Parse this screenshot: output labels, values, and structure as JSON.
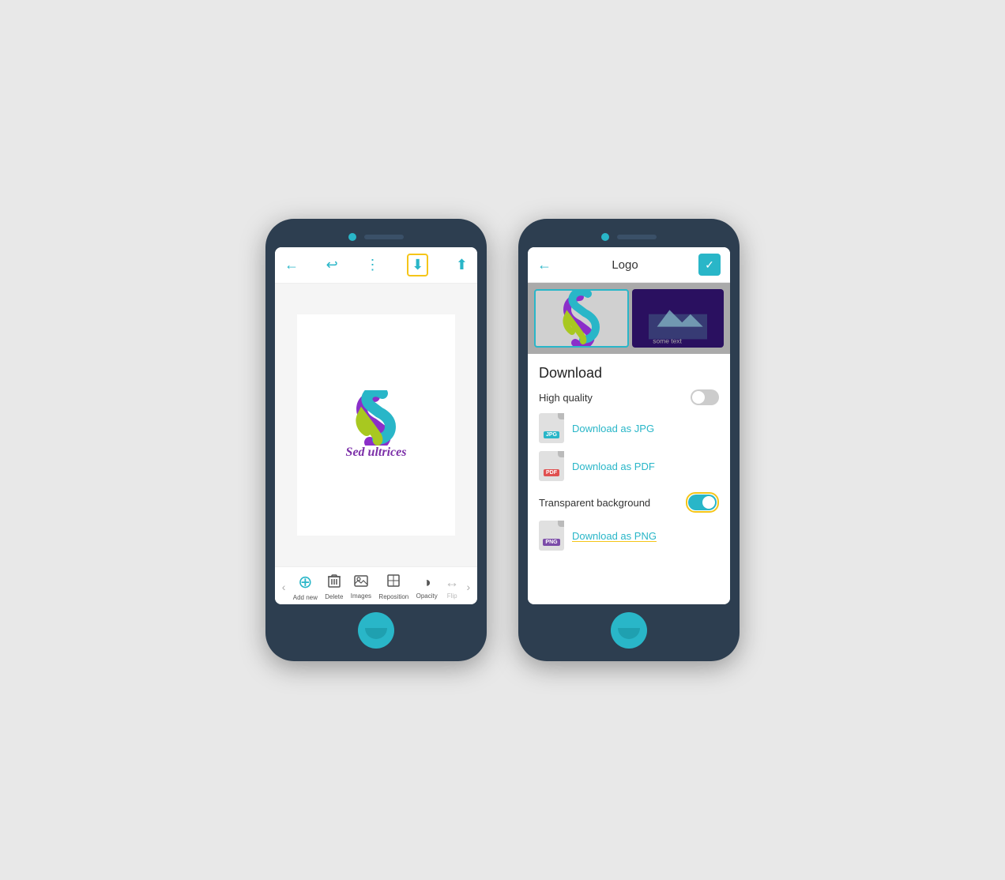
{
  "left_phone": {
    "toolbar": {
      "back_label": "←",
      "undo_label": "↩",
      "more_label": "⋮",
      "download_label": "⬇",
      "share_label": "⬆"
    },
    "canvas": {
      "logo_text": "Sed ultrices"
    },
    "bottom_bar": {
      "items": [
        {
          "label": "Add new",
          "icon": "⊕"
        },
        {
          "label": "Delete",
          "icon": "🗑"
        },
        {
          "label": "Images",
          "icon": "🖼"
        },
        {
          "label": "Reposition",
          "icon": "⊹"
        },
        {
          "label": "Opacity",
          "icon": "◑"
        },
        {
          "label": "Flip",
          "icon": "↔"
        }
      ],
      "nav_right": "›"
    }
  },
  "right_phone": {
    "header": {
      "back_label": "←",
      "title": "Logo",
      "check_label": "✓"
    },
    "download_panel": {
      "title": "Download",
      "high_quality_label": "High quality",
      "high_quality_on": false,
      "options": [
        {
          "badge": "JPG",
          "badge_class": "badge-jpg",
          "link_text": "Download as JPG"
        },
        {
          "badge": "PDF",
          "badge_class": "badge-pdf",
          "link_text": "Download as PDF"
        }
      ],
      "transparent_label": "Transparent background",
      "transparent_on": true,
      "png_link_text": "Download as PNG"
    }
  }
}
